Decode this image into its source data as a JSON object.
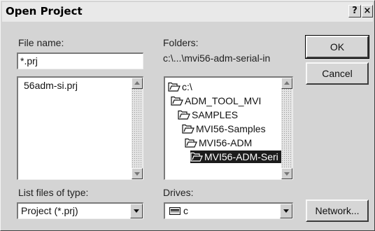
{
  "window": {
    "title": "Open Project",
    "help_button": "?",
    "close_button": "×"
  },
  "file_name": {
    "label": "File name:",
    "value": "*.prj",
    "files": [
      "56adm-si.prj"
    ]
  },
  "folders": {
    "label": "Folders:",
    "current_path": "c:\\...\\mvi56-adm-serial-in",
    "tree": [
      {
        "label": "c:\\",
        "icon": "open-folder-icon",
        "selected": false
      },
      {
        "label": "ADM_TOOL_MVI",
        "icon": "open-folder-icon",
        "selected": false
      },
      {
        "label": "SAMPLES",
        "icon": "open-folder-icon",
        "selected": false
      },
      {
        "label": "MVI56-Samples",
        "icon": "open-folder-icon",
        "selected": false
      },
      {
        "label": "MVI56-ADM",
        "icon": "open-folder-icon",
        "selected": false
      },
      {
        "label": "MVI56-ADM-Seri",
        "icon": "open-folder-icon",
        "selected": true
      }
    ]
  },
  "file_type": {
    "label": "List files of type:",
    "selected": "Project (*.prj)"
  },
  "drives": {
    "label": "Drives:",
    "selected": "c",
    "icon": "drive-icon"
  },
  "buttons": {
    "ok": "OK",
    "cancel": "Cancel",
    "network": "Network..."
  }
}
